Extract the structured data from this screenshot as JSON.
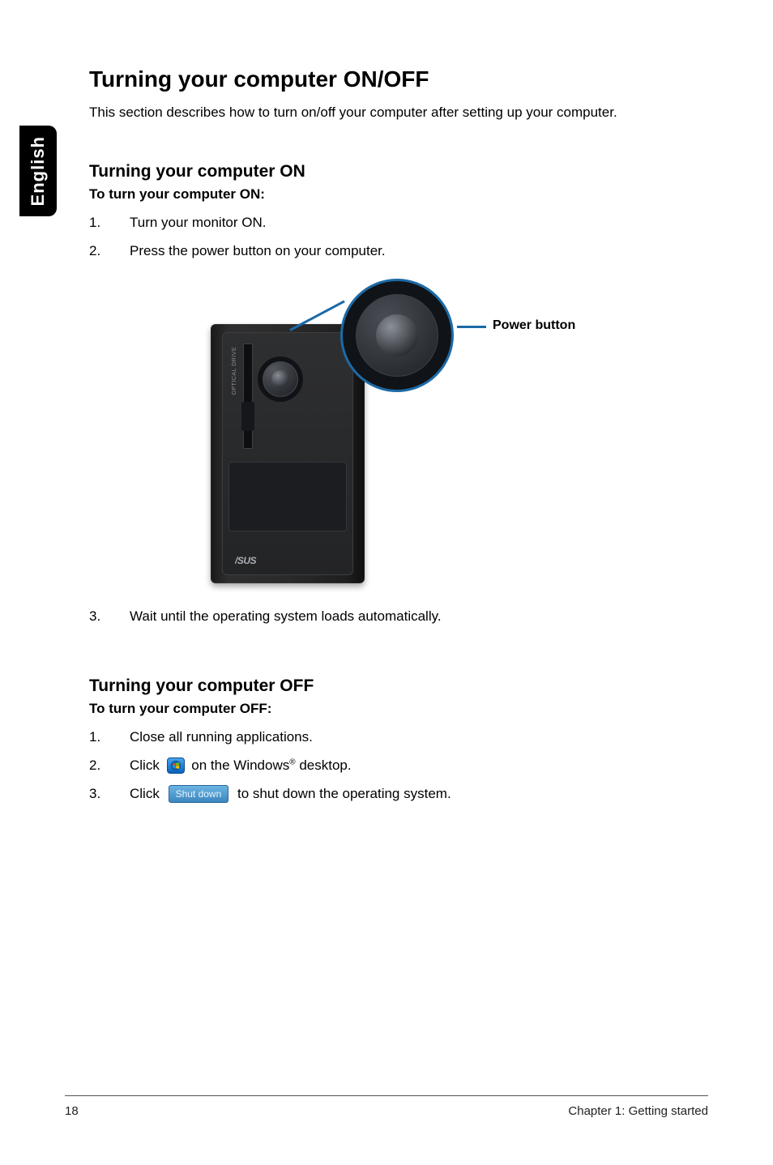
{
  "side_tab": {
    "label": "English"
  },
  "title": "Turning your computer ON/OFF",
  "intro": "This section describes how to turn on/off your computer after setting up your computer.",
  "on": {
    "heading": "Turning your computer ON",
    "sub": "To turn your computer ON:",
    "steps": [
      {
        "n": "1.",
        "t": "Turn your monitor ON."
      },
      {
        "n": "2.",
        "t": "Press the power button on your computer."
      },
      {
        "n": "3.",
        "t": "Wait until the operating system loads automatically."
      }
    ]
  },
  "figure": {
    "callout": "Power button",
    "optical_label": "OPTICAL DRIVE",
    "brand": "ASUS"
  },
  "off": {
    "heading": "Turning your computer OFF",
    "sub": "To turn your computer OFF:",
    "steps": [
      {
        "n": "1.",
        "t": "Close all running applications."
      },
      {
        "n": "2.",
        "pre": "Click ",
        "post_a": " on the Windows",
        "reg": "®",
        "post_b": " desktop."
      },
      {
        "n": "3.",
        "pre": "Click ",
        "btn": "Shut down",
        "post": " to shut down the operating system."
      }
    ]
  },
  "footer": {
    "page": "18",
    "chapter": "Chapter 1: Getting started"
  }
}
